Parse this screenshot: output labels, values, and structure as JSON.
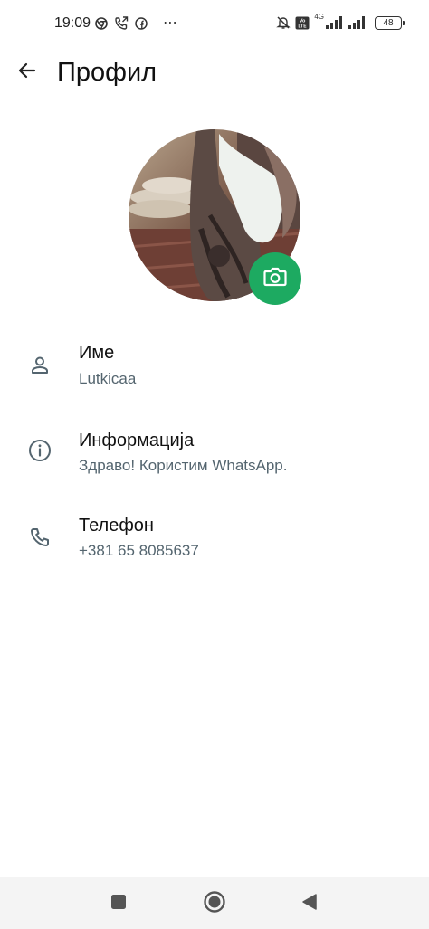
{
  "status_bar": {
    "time": "19:09",
    "left_icons": [
      "chrome-icon",
      "call-forwarding-icon",
      "facebook-icon"
    ],
    "more": "⋯",
    "right_icons": [
      "muted-bell-icon",
      "volte-icon",
      "signal-icon",
      "signal-icon"
    ],
    "network_type": "4G",
    "battery": "48"
  },
  "app_bar": {
    "back_icon": "arrow-back-icon",
    "title": "Профил"
  },
  "avatar": {
    "camera_icon": "camera-icon",
    "accent": "#1daa61"
  },
  "rows": [
    {
      "icon": "person-icon",
      "label": "Име",
      "value": "Lutkicaa"
    },
    {
      "icon": "info-icon",
      "label": "Информација",
      "value": "Здраво! Користим WhatsApp."
    },
    {
      "icon": "phone-icon",
      "label": "Телефон",
      "value": "+381 65 8085637"
    }
  ],
  "nav_bar": {
    "buttons": [
      "recents-icon",
      "home-icon",
      "back-icon"
    ]
  }
}
